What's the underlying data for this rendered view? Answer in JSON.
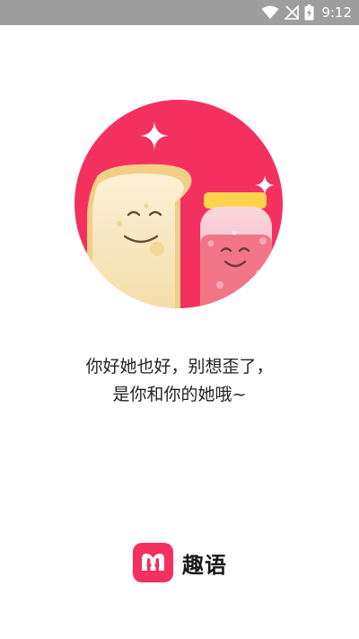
{
  "status_bar": {
    "time": "9:12",
    "icons": [
      "wifi-icon",
      "no-signal-icon",
      "battery-charging-icon"
    ],
    "background": "#9e9e9e"
  },
  "illustration": {
    "icons": [
      "toast-icon",
      "jam-jar-icon",
      "sparkle-icon"
    ],
    "circle_color": "#f4305e"
  },
  "tagline": {
    "line1": "你好她也好，别想歪了，",
    "line2": "是你和你的她哦~"
  },
  "brand": {
    "name": "趣语",
    "logo_color": "#f4305e"
  }
}
